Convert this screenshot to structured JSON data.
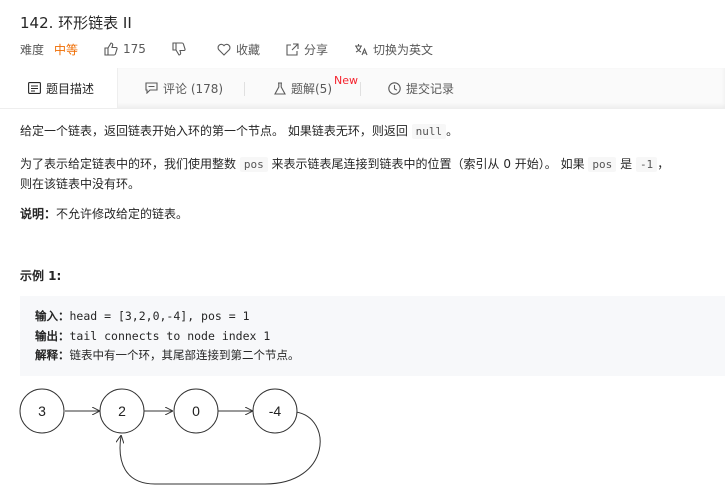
{
  "problem": {
    "title": "142. 环形链表 II",
    "difficulty_label": "难度",
    "difficulty": "中等",
    "likes": "175",
    "favorite_label": "收藏",
    "share_label": "分享",
    "translate_label": "切换为英文"
  },
  "tabs": [
    {
      "label": "题目描述",
      "icon": "description-icon"
    },
    {
      "label": "评论 (178)",
      "icon": "comment-icon"
    },
    {
      "label": "题解(5)",
      "icon": "flask-icon",
      "badge": "New"
    },
    {
      "label": "提交记录",
      "icon": "clock-icon"
    }
  ],
  "description": {
    "p1_text": "给定一个链表，返回链表开始入环的第一个节点。 如果链表无环，则返回 ",
    "p1_code": "null",
    "p1_end": "。",
    "p2_a": "为了表示给定链表中的环，我们使用整数 ",
    "p2_code1": "pos",
    "p2_b": " 来表示链表尾连接到链表中的位置（索引从 0 开始）。 如果 ",
    "p2_code2": "pos",
    "p2_c": " 是 ",
    "p2_code3": "-1",
    "p2_d": "，",
    "p2_line2": "则在该链表中没有环。",
    "note_label": "说明：",
    "note_text": "不允许修改给定的链表。",
    "example_title": "示例 1:",
    "input_label": "输入：",
    "input_value": "head = [3,2,0,-4], pos = 1",
    "output_label": "输出：",
    "output_value": "tail connects to node index 1",
    "explain_label": "解释：",
    "explain_value": "链表中有一个环，其尾部连接到第二个节点。"
  },
  "diagram": {
    "nodes": [
      "3",
      "2",
      "0",
      "-4"
    ]
  },
  "colors": {
    "accent_difficulty": "#ef6c00",
    "new_badge": "#f5222d"
  }
}
